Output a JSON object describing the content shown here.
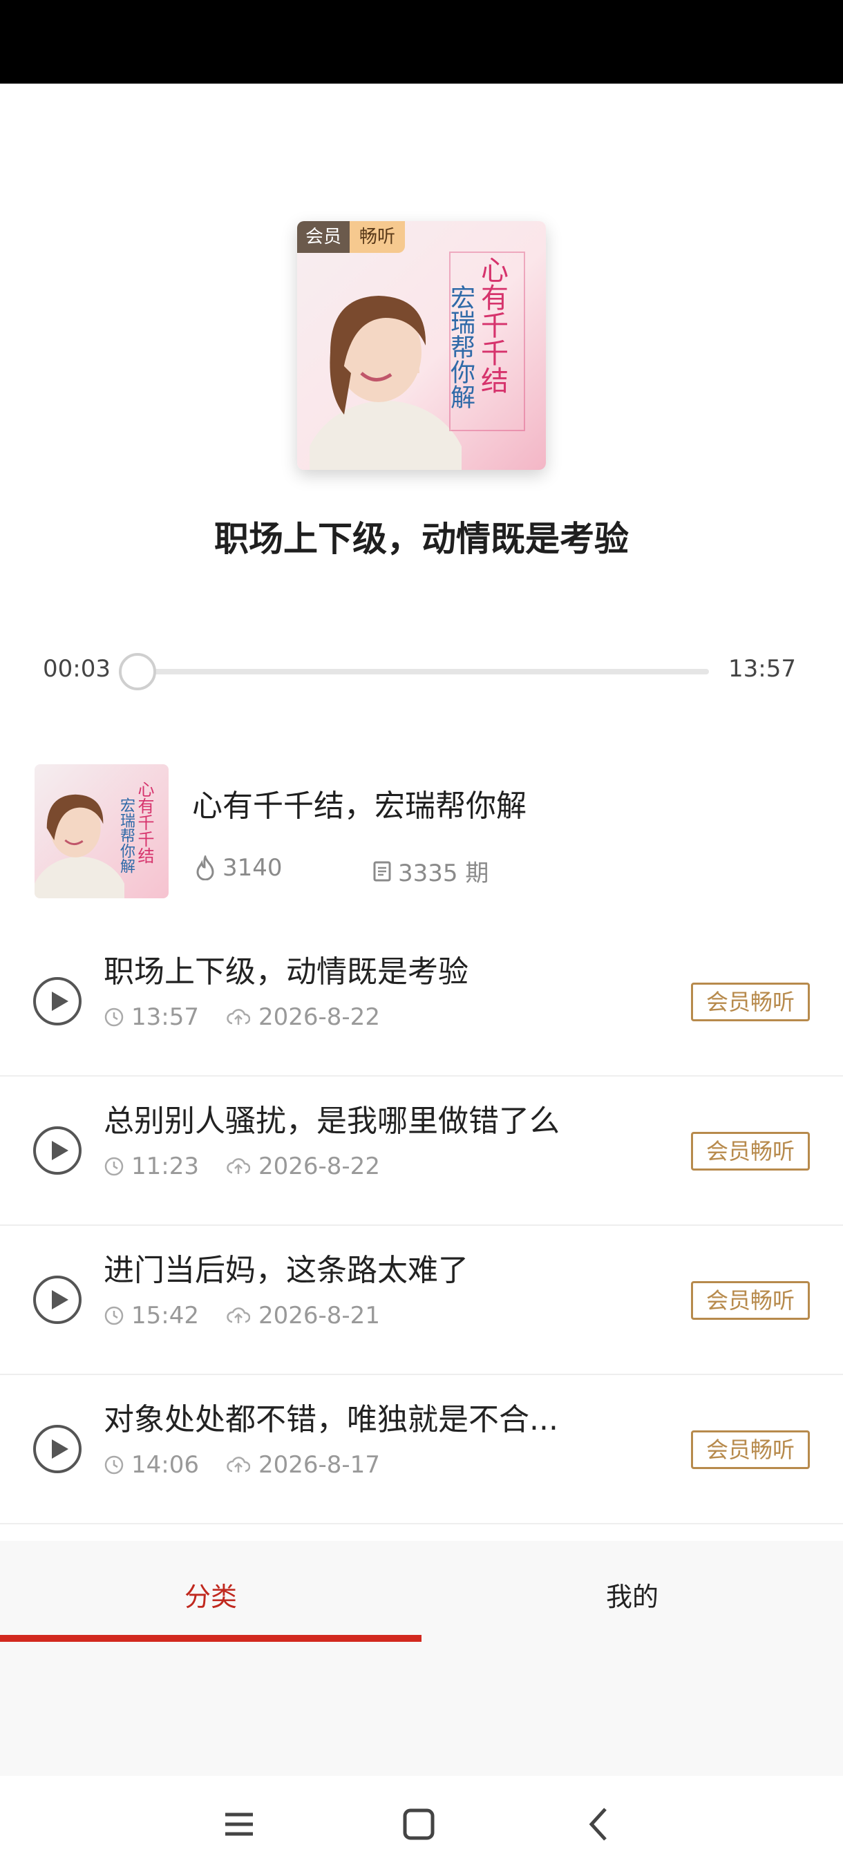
{
  "cover": {
    "badge_member": "会员",
    "badge_listen": "畅听",
    "title_line1": "心有千千结",
    "title_line2": "宏瑞帮你解"
  },
  "now_playing": {
    "title": "职场上下级，动情既是考验",
    "elapsed": "00:03",
    "duration": "13:57",
    "progress_fraction": 0.004
  },
  "album": {
    "name": "心有千千结，宏瑞帮你解",
    "plays": "3140",
    "episodes": "3335 期"
  },
  "episodes": [
    {
      "title": "职场上下级，动情既是考验",
      "duration": "13:57",
      "date": "2026-8-22",
      "badge": "会员畅听"
    },
    {
      "title": "总别别人骚扰，是我哪里做错了么",
      "duration": "11:23",
      "date": "2026-8-22",
      "badge": "会员畅听"
    },
    {
      "title": "进门当后妈，这条路太难了",
      "duration": "15:42",
      "date": "2026-8-21",
      "badge": "会员畅听"
    },
    {
      "title": "对象处处都不错，唯独就是不合...",
      "duration": "14:06",
      "date": "2026-8-17",
      "badge": "会员畅听"
    }
  ],
  "tabs": {
    "classify": "分类",
    "mine": "我的"
  },
  "colors": {
    "accent_red": "#d2291f",
    "badge_gold": "#b78a4c",
    "title_pink": "#d6336c"
  }
}
